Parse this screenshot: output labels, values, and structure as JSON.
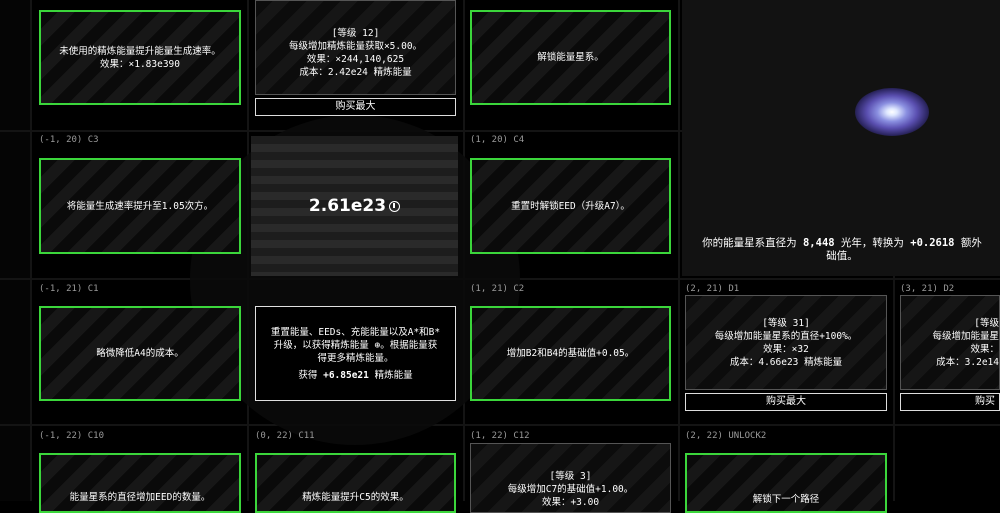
{
  "row1": {
    "card_left": {
      "line1": "未使用的精炼能量提升能量生成速率。",
      "line2": "效果：×1.83e390"
    },
    "card_mid": {
      "level": "[等级 12]",
      "line1": "每级增加精炼能量获取×5.00。",
      "line2": "效果：×244,140,625",
      "line3": "成本：2.42e24 精炼能量",
      "button": "购买最大"
    },
    "card_right": {
      "line1": "解锁能量星系。"
    }
  },
  "row2": {
    "label_left": "(-1, 20) C3",
    "label_right": "(1, 20) C4",
    "card_left": {
      "line1": "将能量生成速率提升至1.05次方。"
    },
    "center_amount": "2.61e23",
    "card_right": {
      "line1": "重置时解锁EED（升级A7）。"
    },
    "galaxy_text": {
      "prefix": "你的能量星系直径为",
      "diameter": "8,448",
      "mid": "光年，转换为",
      "bonus": "+0.2618",
      "suffix": "额外",
      "line2": "础值。"
    }
  },
  "row3": {
    "label_c1": "(-1, 21) C1",
    "label_c2": "(1, 21) C2",
    "label_d1": "(2, 21) D1",
    "label_d2": "(3, 21) D2",
    "card_c1": {
      "line1": "略微降低A4的成本。"
    },
    "card_reset": {
      "line1": "重置能量、EEDs、充能能量以及A*和B*",
      "line2": "升级，以获得精炼能量 ⊕。根据能量获",
      "line3": "得更多精炼能量。",
      "gain_prefix": "获得",
      "gain_value": "+6.85e21",
      "gain_suffix": "精炼能量"
    },
    "card_c2": {
      "line1": "增加B2和B4的基础值+0.05。"
    },
    "card_d1": {
      "level": "[等级 31]",
      "line1": "每级增加能量星系的直径+100%。",
      "line2": "效果：×32",
      "line3": "成本：4.66e23 精炼能量",
      "button": "购买最大"
    },
    "card_d2": {
      "level": "[等级",
      "line1": "每级增加能量星",
      "line2": "效果：",
      "line3": "成本：3.2e14",
      "button": "购买"
    }
  },
  "row4": {
    "label_c10": "(-1, 22) C10",
    "label_c11": "(0, 22) C11",
    "label_c12": "(1, 22) C12",
    "label_unlock": "(2, 22) UNLOCK2",
    "card_c10": {
      "line1": "能量星系的直径增加EED的数量。"
    },
    "card_c11": {
      "line1": "精炼能量提升C5的效果。"
    },
    "card_c12": {
      "level": "[等级 3]",
      "line1": "每级增加C7的基础值+1.00。",
      "line2": "效果：+3.00"
    },
    "card_unlock": {
      "line1": "解锁下一个路径"
    }
  },
  "colors": {
    "green_border": "#3bd63b",
    "gray_border": "#555555",
    "background": "#000000"
  }
}
